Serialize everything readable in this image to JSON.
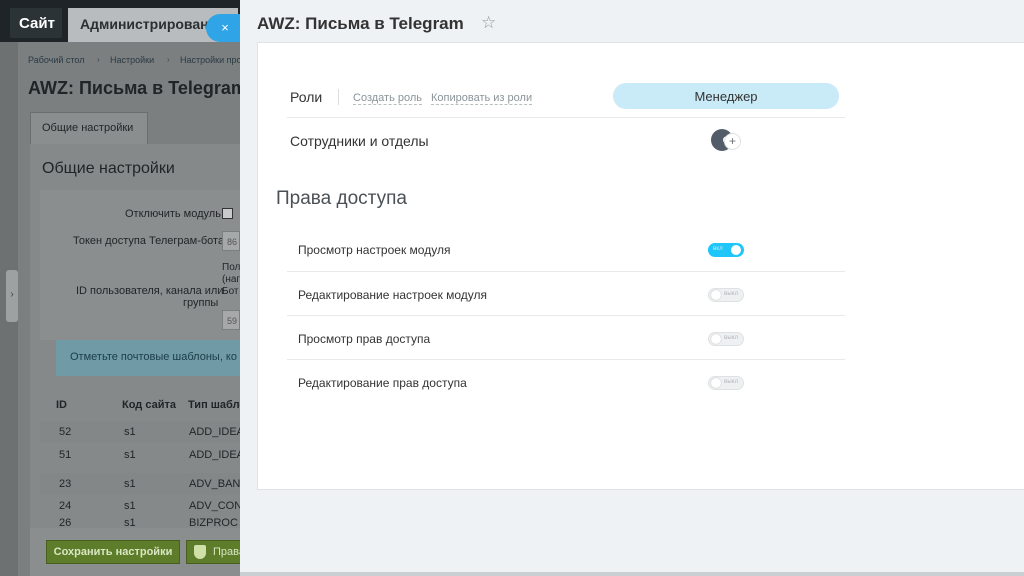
{
  "background": {
    "tabs": {
      "site": "Сайт",
      "admin": "Администрирование"
    },
    "breadcrumbs": [
      "Рабочий стол",
      "Настройки",
      "Настройки про"
    ],
    "page_title": "AWZ: Письма в Telegram",
    "active_tab": "Общие настройки",
    "section_title": "Общие настройки",
    "form": {
      "disable_module": "Отключить модуль",
      "token_label": "Токен доступа Телеграм-бота",
      "token_value": "86",
      "user_id_label_1": "ID пользователя, канала или",
      "user_id_label_2": "группы",
      "hint_1": "Пол",
      "hint_2": "(наг",
      "hint_3": "Бот",
      "user_id_value": "59"
    },
    "note": "Отметьте почтовые шаблоны, ко",
    "table": {
      "headers": [
        "ID",
        "Код сайта",
        "Тип шабло"
      ],
      "rows": [
        [
          "52",
          "s1",
          "ADD_IDEA"
        ],
        [
          "51",
          "s1",
          "ADD_IDEA"
        ],
        [
          "23",
          "s1",
          "ADV_BANI"
        ],
        [
          "24",
          "s1",
          "ADV_CON"
        ],
        [
          "26",
          "s1",
          "BIZPROC"
        ]
      ]
    },
    "buttons": {
      "save": "Сохранить настройки",
      "rights": "Права"
    }
  },
  "slider": {
    "close_symbol": "×",
    "title": "AWZ: Письма в Telegram",
    "star_symbol": "☆",
    "roles": {
      "label": "Роли",
      "create_role": "Создать роль",
      "copy_role": "Копировать из роли",
      "current_role": "Менеджер"
    },
    "staff": {
      "label": "Сотрудники и отделы",
      "add_symbol": "+"
    },
    "access": {
      "title": "Права доступа",
      "permissions": [
        {
          "label": "Просмотр настроек модуля",
          "state": "on",
          "toggle_text": "вкл"
        },
        {
          "label": "Редактирование настроек модуля",
          "state": "off",
          "toggle_text": "выкл"
        },
        {
          "label": "Просмотр прав доступа",
          "state": "off",
          "toggle_text": "выкл"
        },
        {
          "label": "Редактирование прав доступа",
          "state": "off",
          "toggle_text": "выкл"
        }
      ]
    },
    "colors": {
      "accent": "#1ec6fa",
      "role_pill": "#c9eaf7",
      "close_button": "#2fa4e7"
    }
  }
}
